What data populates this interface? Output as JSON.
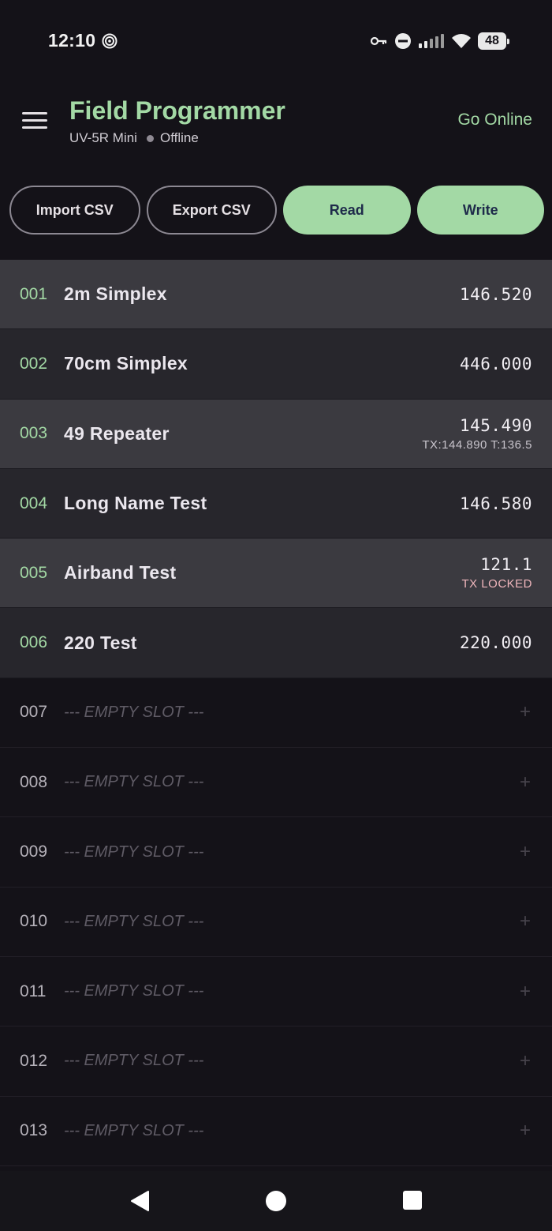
{
  "status_bar": {
    "time": "12:10",
    "battery": "48",
    "icons": [
      "spiral-icon",
      "key-icon",
      "dnd-icon",
      "signal-icon",
      "wifi-icon",
      "battery-icon"
    ]
  },
  "header": {
    "title": "Field Programmer",
    "device": "UV-5R Mini",
    "connection_status": "Offline",
    "go_online_label": "Go Online"
  },
  "actions": {
    "import_label": "Import CSV",
    "export_label": "Export CSV",
    "read_label": "Read",
    "write_label": "Write"
  },
  "channels": [
    {
      "num": "001",
      "name": "2m Simplex",
      "freq": "146.520",
      "detail": ""
    },
    {
      "num": "002",
      "name": "70cm Simplex",
      "freq": "446.000",
      "detail": ""
    },
    {
      "num": "003",
      "name": "49 Repeater",
      "freq": "145.490",
      "detail": "TX:144.890 T:136.5"
    },
    {
      "num": "004",
      "name": "Long Name Test",
      "freq": "146.580",
      "detail": ""
    },
    {
      "num": "005",
      "name": "Airband Test",
      "freq": "121.1",
      "warning": "TX LOCKED"
    },
    {
      "num": "006",
      "name": "220 Test",
      "freq": "220.000",
      "detail": ""
    }
  ],
  "empty_slots": [
    {
      "num": "007",
      "label": "--- EMPTY SLOT ---",
      "add": "+"
    },
    {
      "num": "008",
      "label": "--- EMPTY SLOT ---",
      "add": "+"
    },
    {
      "num": "009",
      "label": "--- EMPTY SLOT ---",
      "add": "+"
    },
    {
      "num": "010",
      "label": "--- EMPTY SLOT ---",
      "add": "+"
    },
    {
      "num": "011",
      "label": "--- EMPTY SLOT ---",
      "add": "+"
    },
    {
      "num": "012",
      "label": "--- EMPTY SLOT ---",
      "add": "+"
    },
    {
      "num": "013",
      "label": "--- EMPTY SLOT ---",
      "add": "+"
    }
  ],
  "colors": {
    "accent": "#a3d9a5",
    "background": "#141218",
    "warning": "#f0b6bc"
  },
  "nav_bar": {
    "icons": [
      "back-icon",
      "home-icon",
      "recents-icon"
    ]
  }
}
